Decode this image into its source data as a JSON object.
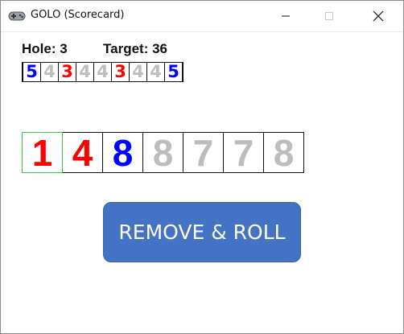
{
  "window": {
    "title": "GOLO (Scorecard)",
    "app_icon": "gamepad-icon",
    "controls": [
      "minimize-icon",
      "maximize-icon",
      "close-icon"
    ]
  },
  "status": {
    "hole_label": "Hole: 3",
    "target_label": "Target: 36"
  },
  "scorecard": {
    "cells": [
      {
        "value": "5",
        "color": "#0000ff"
      },
      {
        "value": "4",
        "color": "#bdbdbd"
      },
      {
        "value": "3",
        "color": "#ff0000"
      },
      {
        "value": "4",
        "color": "#bdbdbd"
      },
      {
        "value": "4",
        "color": "#bdbdbd"
      },
      {
        "value": "3",
        "color": "#ff0000"
      },
      {
        "value": "4",
        "color": "#bdbdbd"
      },
      {
        "value": "4",
        "color": "#bdbdbd"
      },
      {
        "value": "5",
        "color": "#0000ff"
      }
    ]
  },
  "dice": [
    {
      "value": "1",
      "color": "#ff0000",
      "selected": true
    },
    {
      "value": "4",
      "color": "#ff0000",
      "selected": false
    },
    {
      "value": "8",
      "color": "#0000ff",
      "selected": false
    },
    {
      "value": "8",
      "color": "#bdbdbd",
      "selected": false
    },
    {
      "value": "7",
      "color": "#bdbdbd",
      "selected": false
    },
    {
      "value": "7",
      "color": "#bdbdbd",
      "selected": false
    },
    {
      "value": "8",
      "color": "#bdbdbd",
      "selected": false
    }
  ],
  "colors": {
    "accent": "#4472c4",
    "selected_border": "#2ecc40"
  },
  "actions": {
    "roll_label": "REMOVE & ROLL"
  }
}
